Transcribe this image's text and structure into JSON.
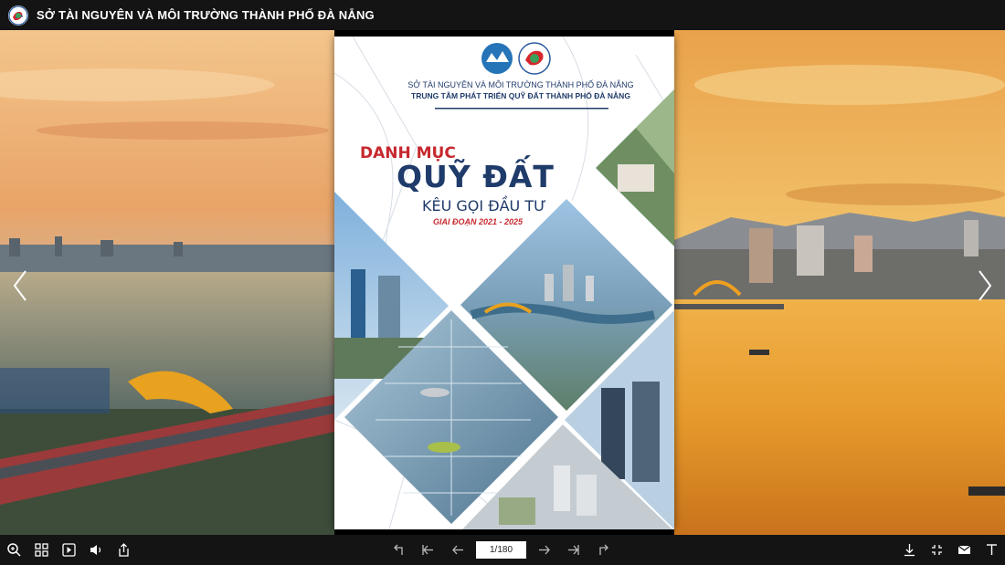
{
  "header": {
    "title": "SỞ TÀI NGUYÊN VÀ MÔI TRƯỜNG THÀNH PHỐ ĐÀ NẴNG"
  },
  "cover": {
    "org_line1": "SỞ TÀI NGUYÊN VÀ MÔI TRƯỜNG THÀNH PHỐ ĐÀ NẴNG",
    "org_line2": "TRUNG TÂM PHÁT TRIỂN QUỸ ĐẤT THÀNH PHỐ ĐÀ NẴNG",
    "title_line1": "DANH MỤC",
    "title_line2": "QUỸ ĐẤT",
    "title_line3": "KÊU GỌI ĐẦU TƯ",
    "period": "GIAI ĐOẠN 2021 - 2025"
  },
  "toolbar": {
    "page_indicator": "1/180",
    "left_tools": [
      "zoom-icon",
      "thumbnails-icon",
      "autoplay-icon",
      "sound-icon",
      "share-icon"
    ],
    "center_tools": [
      "undo-icon",
      "first-page-icon",
      "previous-page-icon",
      "next-page-icon",
      "last-page-icon",
      "redo-icon"
    ],
    "right_tools": [
      "download-icon",
      "fullscreen-icon",
      "email-icon",
      "text-icon"
    ]
  },
  "colors": {
    "bar_background": "#141414",
    "cover_title_red": "#c7282f",
    "cover_title_blue": "#1f3b6a"
  }
}
